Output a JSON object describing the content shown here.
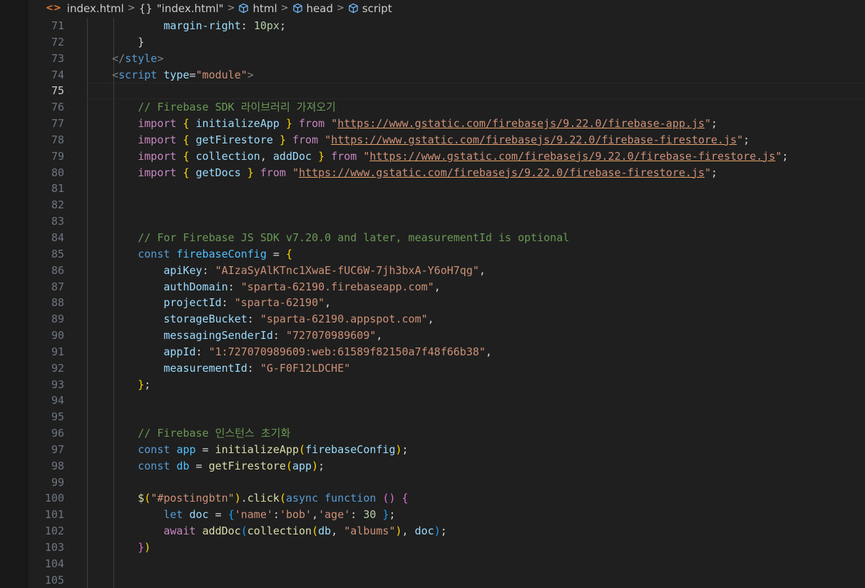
{
  "breadcrumb": {
    "file": "index.html",
    "scope": "\"index.html\"",
    "scope_icon": "{}",
    "html": "html",
    "head": "head",
    "script": "script",
    "separator": ">"
  },
  "colors": {
    "keyword": "#569cd6",
    "control": "#c586c0",
    "string": "#ce9178",
    "function": "#dcdcaa",
    "variable": "#9cdcfe",
    "const": "#4fc1ff",
    "number": "#b5cea8",
    "comment": "#6a9955",
    "line_number": "#6e7681"
  },
  "editor": {
    "current_line": 75,
    "lines": [
      {
        "n": 71,
        "indent": 3,
        "tokens": [
          [
            "v",
            "margin-right"
          ],
          [
            "p",
            ": "
          ],
          [
            "n",
            "10px"
          ],
          [
            "p",
            ";"
          ]
        ]
      },
      {
        "n": 72,
        "indent": 2,
        "tokens": [
          [
            "p",
            "}"
          ]
        ]
      },
      {
        "n": 73,
        "indent": 1,
        "tokens": [
          [
            "ang",
            "</"
          ],
          [
            "t",
            "style"
          ],
          [
            "ang",
            ">"
          ]
        ]
      },
      {
        "n": 74,
        "indent": 1,
        "tokens": [
          [
            "ang",
            "<"
          ],
          [
            "t",
            "script"
          ],
          [
            "p",
            " "
          ],
          [
            "a",
            "type"
          ],
          [
            "p",
            "="
          ],
          [
            "s",
            "\"module\""
          ],
          [
            "ang",
            ">"
          ]
        ]
      },
      {
        "n": 75,
        "indent": 0,
        "tokens": []
      },
      {
        "n": 76,
        "indent": 2,
        "tokens": [
          [
            "cm",
            "// Firebase SDK 라이브러리 가져오기"
          ]
        ]
      },
      {
        "n": 77,
        "indent": 2,
        "tokens": [
          [
            "c",
            "import"
          ],
          [
            "p",
            " "
          ],
          [
            "b1",
            "{"
          ],
          [
            "p",
            " "
          ],
          [
            "v",
            "initializeApp"
          ],
          [
            "p",
            " "
          ],
          [
            "b1",
            "}"
          ],
          [
            "p",
            " "
          ],
          [
            "c",
            "from"
          ],
          [
            "p",
            " "
          ],
          [
            "s",
            "\""
          ],
          [
            "su",
            "https://www.gstatic.com/firebasejs/9.22.0/firebase-app.js"
          ],
          [
            "s",
            "\""
          ],
          [
            "p",
            ";"
          ]
        ]
      },
      {
        "n": 78,
        "indent": 2,
        "tokens": [
          [
            "c",
            "import"
          ],
          [
            "p",
            " "
          ],
          [
            "b1",
            "{"
          ],
          [
            "p",
            " "
          ],
          [
            "v",
            "getFirestore"
          ],
          [
            "p",
            " "
          ],
          [
            "b1",
            "}"
          ],
          [
            "p",
            " "
          ],
          [
            "c",
            "from"
          ],
          [
            "p",
            " "
          ],
          [
            "s",
            "\""
          ],
          [
            "su",
            "https://www.gstatic.com/firebasejs/9.22.0/firebase-firestore.js"
          ],
          [
            "s",
            "\""
          ],
          [
            "p",
            ";"
          ]
        ]
      },
      {
        "n": 79,
        "indent": 2,
        "tokens": [
          [
            "c",
            "import"
          ],
          [
            "p",
            " "
          ],
          [
            "b1",
            "{"
          ],
          [
            "p",
            " "
          ],
          [
            "v",
            "collection"
          ],
          [
            "p",
            ", "
          ],
          [
            "v",
            "addDoc"
          ],
          [
            "p",
            " "
          ],
          [
            "b1",
            "}"
          ],
          [
            "p",
            " "
          ],
          [
            "c",
            "from"
          ],
          [
            "p",
            " "
          ],
          [
            "s",
            "\""
          ],
          [
            "su",
            "https://www.gstatic.com/firebasejs/9.22.0/firebase-firestore.js"
          ],
          [
            "s",
            "\""
          ],
          [
            "p",
            ";"
          ]
        ]
      },
      {
        "n": 80,
        "indent": 2,
        "tokens": [
          [
            "c",
            "import"
          ],
          [
            "p",
            " "
          ],
          [
            "b1",
            "{"
          ],
          [
            "p",
            " "
          ],
          [
            "v",
            "getDocs"
          ],
          [
            "p",
            " "
          ],
          [
            "b1",
            "}"
          ],
          [
            "p",
            " "
          ],
          [
            "c",
            "from"
          ],
          [
            "p",
            " "
          ],
          [
            "s",
            "\""
          ],
          [
            "su",
            "https://www.gstatic.com/firebasejs/9.22.0/firebase-firestore.js"
          ],
          [
            "s",
            "\""
          ],
          [
            "p",
            ";"
          ]
        ]
      },
      {
        "n": 81,
        "indent": 0,
        "tokens": []
      },
      {
        "n": 82,
        "indent": 0,
        "tokens": []
      },
      {
        "n": 83,
        "indent": 0,
        "tokens": []
      },
      {
        "n": 84,
        "indent": 2,
        "tokens": [
          [
            "cm",
            "// For Firebase JS SDK v7.20.0 and later, measurementId is optional"
          ]
        ]
      },
      {
        "n": 85,
        "indent": 2,
        "tokens": [
          [
            "k",
            "const"
          ],
          [
            "p",
            " "
          ],
          [
            "cv",
            "firebaseConfig"
          ],
          [
            "p",
            " = "
          ],
          [
            "b1",
            "{"
          ]
        ]
      },
      {
        "n": 86,
        "indent": 3,
        "tokens": [
          [
            "v",
            "apiKey"
          ],
          [
            "p",
            ": "
          ],
          [
            "s",
            "\"AIzaSyAlKTnc1XwaE-fUC6W-7jh3bxA-Y6oH7qg\""
          ],
          [
            "p",
            ","
          ]
        ]
      },
      {
        "n": 87,
        "indent": 3,
        "tokens": [
          [
            "v",
            "authDomain"
          ],
          [
            "p",
            ": "
          ],
          [
            "s",
            "\"sparta-62190.firebaseapp.com\""
          ],
          [
            "p",
            ","
          ]
        ]
      },
      {
        "n": 88,
        "indent": 3,
        "tokens": [
          [
            "v",
            "projectId"
          ],
          [
            "p",
            ": "
          ],
          [
            "s",
            "\"sparta-62190\""
          ],
          [
            "p",
            ","
          ]
        ]
      },
      {
        "n": 89,
        "indent": 3,
        "tokens": [
          [
            "v",
            "storageBucket"
          ],
          [
            "p",
            ": "
          ],
          [
            "s",
            "\"sparta-62190.appspot.com\""
          ],
          [
            "p",
            ","
          ]
        ]
      },
      {
        "n": 90,
        "indent": 3,
        "tokens": [
          [
            "v",
            "messagingSenderId"
          ],
          [
            "p",
            ": "
          ],
          [
            "s",
            "\"727070989609\""
          ],
          [
            "p",
            ","
          ]
        ]
      },
      {
        "n": 91,
        "indent": 3,
        "tokens": [
          [
            "v",
            "appId"
          ],
          [
            "p",
            ": "
          ],
          [
            "s",
            "\"1:727070989609:web:61589f82150a7f48f66b38\""
          ],
          [
            "p",
            ","
          ]
        ]
      },
      {
        "n": 92,
        "indent": 3,
        "tokens": [
          [
            "v",
            "measurementId"
          ],
          [
            "p",
            ": "
          ],
          [
            "s",
            "\"G-F0F12LDCHE\""
          ]
        ]
      },
      {
        "n": 93,
        "indent": 2,
        "tokens": [
          [
            "b1",
            "}"
          ],
          [
            "p",
            ";"
          ]
        ]
      },
      {
        "n": 94,
        "indent": 0,
        "tokens": []
      },
      {
        "n": 95,
        "indent": 0,
        "tokens": []
      },
      {
        "n": 96,
        "indent": 2,
        "tokens": [
          [
            "cm",
            "// Firebase 인스턴스 초기화"
          ]
        ]
      },
      {
        "n": 97,
        "indent": 2,
        "tokens": [
          [
            "k",
            "const"
          ],
          [
            "p",
            " "
          ],
          [
            "cv",
            "app"
          ],
          [
            "p",
            " = "
          ],
          [
            "f",
            "initializeApp"
          ],
          [
            "b1",
            "("
          ],
          [
            "v",
            "firebaseConfig"
          ],
          [
            "b1",
            ")"
          ],
          [
            "p",
            ";"
          ]
        ]
      },
      {
        "n": 98,
        "indent": 2,
        "tokens": [
          [
            "k",
            "const"
          ],
          [
            "p",
            " "
          ],
          [
            "cv",
            "db"
          ],
          [
            "p",
            " = "
          ],
          [
            "f",
            "getFirestore"
          ],
          [
            "b1",
            "("
          ],
          [
            "v",
            "app"
          ],
          [
            "b1",
            ")"
          ],
          [
            "p",
            ";"
          ]
        ]
      },
      {
        "n": 99,
        "indent": 0,
        "tokens": []
      },
      {
        "n": 100,
        "indent": 2,
        "tokens": [
          [
            "f",
            "$"
          ],
          [
            "b1",
            "("
          ],
          [
            "s",
            "\"#postingbtn\""
          ],
          [
            "b1",
            ")"
          ],
          [
            "p",
            "."
          ],
          [
            "f",
            "click"
          ],
          [
            "b1",
            "("
          ],
          [
            "k",
            "async"
          ],
          [
            "p",
            " "
          ],
          [
            "k",
            "function"
          ],
          [
            "p",
            " "
          ],
          [
            "b2",
            "()"
          ],
          [
            "p",
            " "
          ],
          [
            "b2",
            "{"
          ]
        ]
      },
      {
        "n": 101,
        "indent": 3,
        "tokens": [
          [
            "k",
            "let"
          ],
          [
            "p",
            " "
          ],
          [
            "v",
            "doc"
          ],
          [
            "p",
            " = "
          ],
          [
            "b3",
            "{"
          ],
          [
            "s",
            "'name'"
          ],
          [
            "p",
            ":"
          ],
          [
            "s",
            "'bob'"
          ],
          [
            "p",
            ","
          ],
          [
            "s",
            "'age'"
          ],
          [
            "p",
            ": "
          ],
          [
            "n",
            "30"
          ],
          [
            "p",
            " "
          ],
          [
            "b3",
            "}"
          ],
          [
            "p",
            ";"
          ]
        ]
      },
      {
        "n": 102,
        "indent": 3,
        "tokens": [
          [
            "c",
            "await"
          ],
          [
            "p",
            " "
          ],
          [
            "f",
            "addDoc"
          ],
          [
            "b3",
            "("
          ],
          [
            "f",
            "collection"
          ],
          [
            "b1",
            "("
          ],
          [
            "v",
            "db"
          ],
          [
            "p",
            ", "
          ],
          [
            "s",
            "\"albums\""
          ],
          [
            "b1",
            ")"
          ],
          [
            "p",
            ", "
          ],
          [
            "v",
            "doc"
          ],
          [
            "b3",
            ")"
          ],
          [
            "p",
            ";"
          ]
        ]
      },
      {
        "n": 103,
        "indent": 2,
        "tokens": [
          [
            "b2",
            "}"
          ],
          [
            "b1",
            ")"
          ]
        ]
      },
      {
        "n": 104,
        "indent": 0,
        "tokens": []
      },
      {
        "n": 105,
        "indent": 0,
        "tokens": []
      }
    ]
  }
}
